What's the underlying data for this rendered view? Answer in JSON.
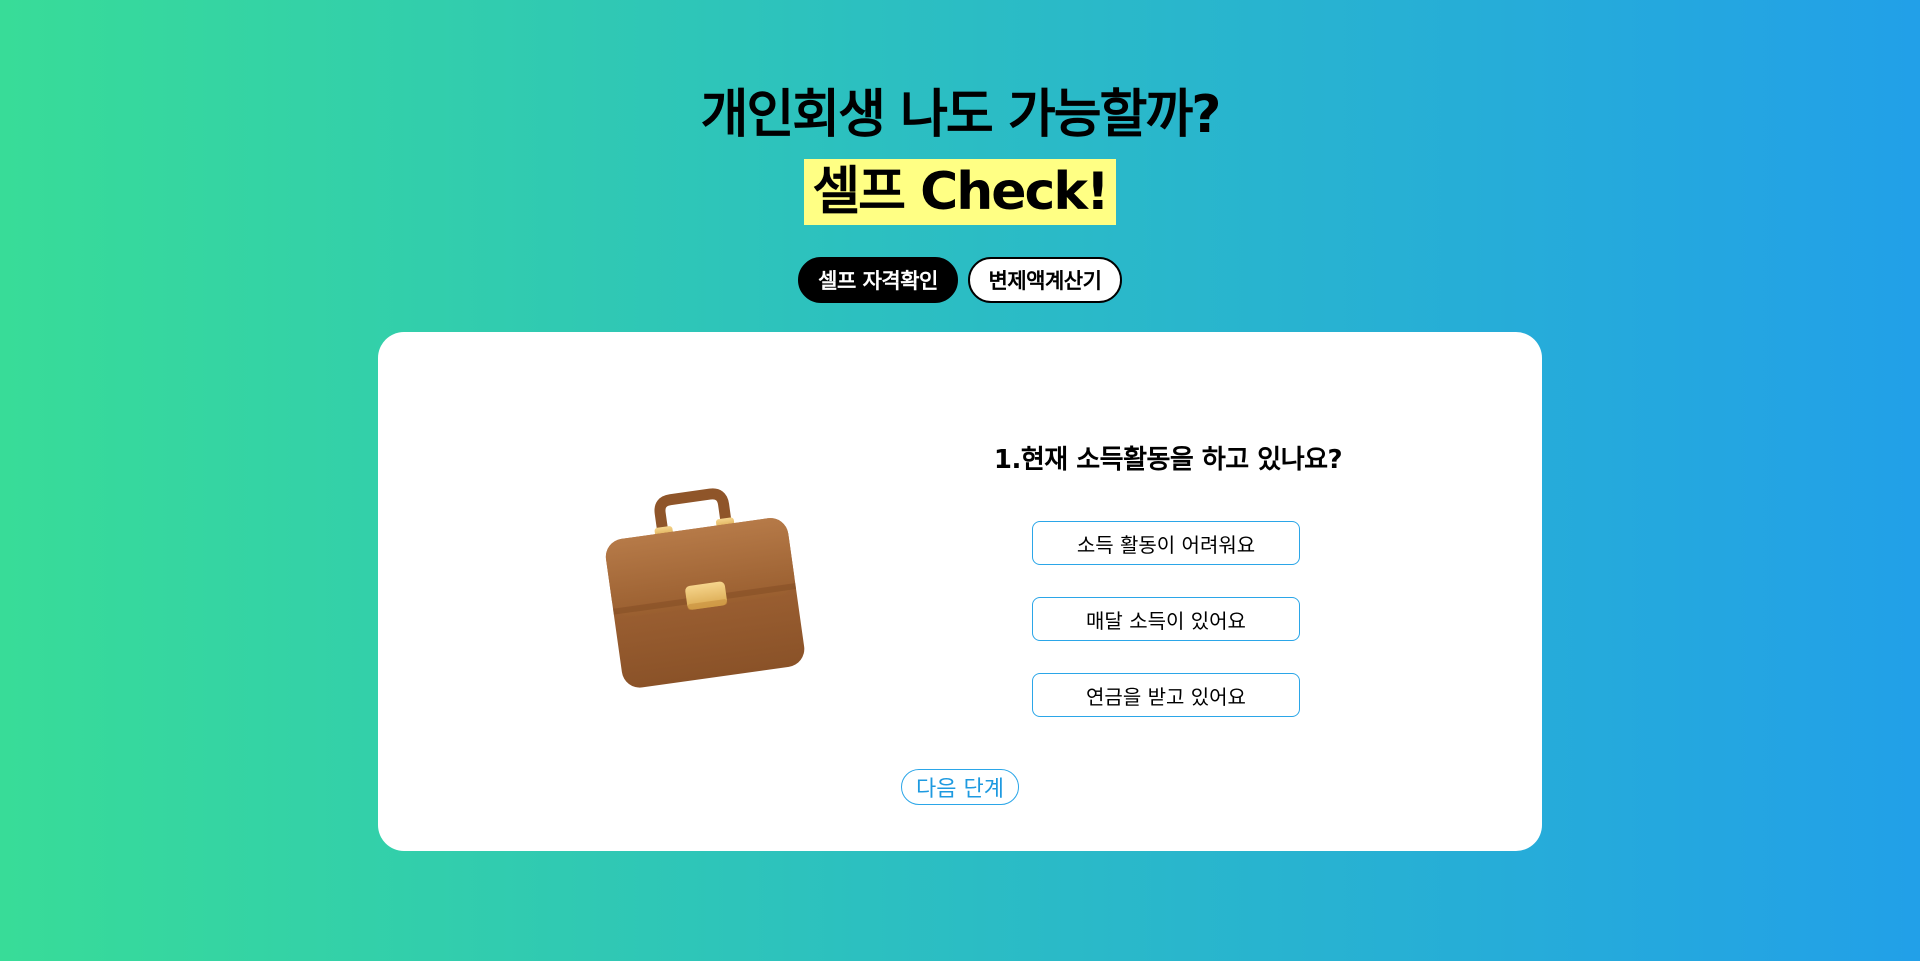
{
  "header": {
    "title_line1": "개인회생 나도 가능할까?",
    "title_line2": "셀프 Check!"
  },
  "tabs": [
    {
      "label": "셀프 자격확인",
      "active": true
    },
    {
      "label": "변제액계산기",
      "active": false
    }
  ],
  "quiz": {
    "image_icon": "briefcase-icon",
    "question": "1.현재 소득활동을 하고 있나요?",
    "options": [
      {
        "label": "소득 활동이 어려워요"
      },
      {
        "label": "매달 소득이 있어요"
      },
      {
        "label": "연금을 받고 있어요"
      }
    ],
    "next_label": "다음 단계"
  },
  "colors": {
    "gradient_start": "#38dc98",
    "gradient_end": "#22a0e8",
    "highlight": "#ffff84",
    "accent_blue": "#2ba6e8"
  }
}
